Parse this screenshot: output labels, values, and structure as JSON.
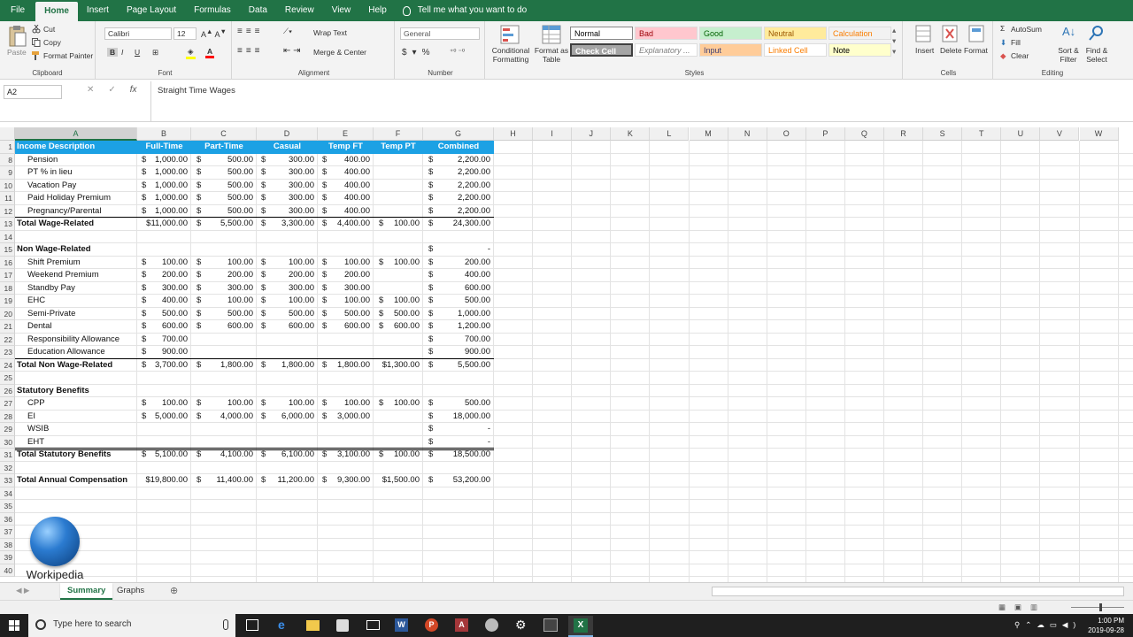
{
  "ribbon_tabs": [
    "File",
    "Home",
    "Insert",
    "Page Layout",
    "Formulas",
    "Data",
    "Review",
    "View",
    "Help"
  ],
  "active_tab": "Home",
  "tell_me": "Tell me what you want to do",
  "clipboard": {
    "paste": "Paste",
    "cut": "Cut",
    "copy": "Copy",
    "painter": "Format Painter",
    "label": "Clipboard"
  },
  "font": {
    "name": "Calibri",
    "size": "12",
    "label": "Font"
  },
  "alignment": {
    "wrap": "Wrap Text",
    "merge": "Merge & Center",
    "label": "Alignment"
  },
  "number": {
    "format": "General",
    "label": "Number"
  },
  "styles": {
    "conditional": "Conditional Formatting",
    "format_table": "Format as Table",
    "label": "Styles",
    "cells": [
      {
        "text": "Normal",
        "bg": "#ffffff",
        "fg": "#000000"
      },
      {
        "text": "Bad",
        "bg": "#ffc7ce",
        "fg": "#9c0006"
      },
      {
        "text": "Good",
        "bg": "#c6efce",
        "fg": "#006100"
      },
      {
        "text": "Neutral",
        "bg": "#ffeb9c",
        "fg": "#9c5700"
      },
      {
        "text": "Calculation",
        "bg": "#f2f2f2",
        "fg": "#fa7d00"
      },
      {
        "text": "Check Cell",
        "bg": "#a5a5a5",
        "fg": "#ffffff"
      },
      {
        "text": "Explanatory ...",
        "bg": "#ffffff",
        "fg": "#7f7f7f"
      },
      {
        "text": "Input",
        "bg": "#ffcc99",
        "fg": "#3f3f76"
      },
      {
        "text": "Linked Cell",
        "bg": "#ffffff",
        "fg": "#fa7d00"
      },
      {
        "text": "Note",
        "bg": "#ffffcc",
        "fg": "#000000"
      }
    ]
  },
  "cells_group": {
    "insert": "Insert",
    "delete": "Delete",
    "format": "Format",
    "label": "Cells"
  },
  "editing": {
    "autosum": "AutoSum",
    "fill": "Fill",
    "clear": "Clear",
    "sort": "Sort & Filter",
    "find": "Find & Select",
    "label": "Editing"
  },
  "formula_bar": {
    "name_box": "A2",
    "content": "Straight Time Wages"
  },
  "columns": [
    "A",
    "B",
    "C",
    "D",
    "E",
    "F",
    "G",
    "H",
    "I",
    "J",
    "K",
    "L",
    "M",
    "N",
    "O",
    "P",
    "Q",
    "R",
    "S",
    "T",
    "U",
    "V",
    "W"
  ],
  "header_row": [
    "Income Description",
    "Full-Time",
    "Part-Time",
    "Casual",
    "Temp FT",
    "Temp PT",
    "Combined"
  ],
  "rows": [
    {
      "r": "1"
    },
    {
      "r": "8",
      "a": "Pension",
      "indent": true,
      "v": [
        "1,000.00",
        "500.00",
        "300.00",
        "400.00",
        "",
        "2,200.00"
      ]
    },
    {
      "r": "9",
      "a": "PT % in lieu",
      "indent": true,
      "v": [
        "1,000.00",
        "500.00",
        "300.00",
        "400.00",
        "",
        "2,200.00"
      ]
    },
    {
      "r": "10",
      "a": "Vacation Pay",
      "indent": true,
      "v": [
        "1,000.00",
        "500.00",
        "300.00",
        "400.00",
        "",
        "2,200.00"
      ]
    },
    {
      "r": "11",
      "a": "Paid Holiday Premium",
      "indent": true,
      "v": [
        "1,000.00",
        "500.00",
        "300.00",
        "400.00",
        "",
        "2,200.00"
      ]
    },
    {
      "r": "12",
      "a": "Pregnancy/Parental",
      "indent": true,
      "v": [
        "1,000.00",
        "500.00",
        "300.00",
        "400.00",
        "",
        "2,200.00"
      ]
    },
    {
      "r": "13",
      "a": "Total Wage-Related",
      "bold": true,
      "total": true,
      "v": [
        "$11,000.00",
        "5,500.00",
        "3,300.00",
        "4,400.00",
        "100.00",
        "24,300.00"
      ]
    },
    {
      "r": "14"
    },
    {
      "r": "15",
      "a": "Non Wage-Related",
      "bold": true,
      "v": [
        "",
        "",
        "",
        "",
        "",
        "-"
      ]
    },
    {
      "r": "16",
      "a": "Shift Premium",
      "indent": true,
      "v": [
        "100.00",
        "100.00",
        "100.00",
        "100.00",
        "100.00",
        "200.00"
      ]
    },
    {
      "r": "17",
      "a": "Weekend Premium",
      "indent": true,
      "v": [
        "200.00",
        "200.00",
        "200.00",
        "200.00",
        "",
        "400.00"
      ]
    },
    {
      "r": "18",
      "a": "Standby Pay",
      "indent": true,
      "v": [
        "300.00",
        "300.00",
        "300.00",
        "300.00",
        "",
        "600.00"
      ]
    },
    {
      "r": "19",
      "a": "EHC",
      "indent": true,
      "v": [
        "400.00",
        "100.00",
        "100.00",
        "100.00",
        "100.00",
        "500.00"
      ]
    },
    {
      "r": "20",
      "a": "Semi-Private",
      "indent": true,
      "v": [
        "500.00",
        "500.00",
        "500.00",
        "500.00",
        "500.00",
        "1,000.00"
      ]
    },
    {
      "r": "21",
      "a": "Dental",
      "indent": true,
      "v": [
        "600.00",
        "600.00",
        "600.00",
        "600.00",
        "600.00",
        "1,200.00"
      ]
    },
    {
      "r": "22",
      "a": "Responsibility Allowance",
      "indent": true,
      "v": [
        "700.00",
        "",
        "",
        "",
        "",
        "700.00"
      ]
    },
    {
      "r": "23",
      "a": "Education Allowance",
      "indent": true,
      "v": [
        "900.00",
        "",
        "",
        "",
        "",
        "900.00"
      ]
    },
    {
      "r": "24",
      "a": "Total Non Wage-Related",
      "bold": true,
      "total": true,
      "v": [
        "3,700.00",
        "1,800.00",
        "1,800.00",
        "1,800.00",
        "$1,300.00",
        "5,500.00"
      ]
    },
    {
      "r": "25"
    },
    {
      "r": "26",
      "a": "Statutory Benefits",
      "bold": true
    },
    {
      "r": "27",
      "a": "CPP",
      "indent": true,
      "v": [
        "100.00",
        "100.00",
        "100.00",
        "100.00",
        "100.00",
        "500.00"
      ]
    },
    {
      "r": "28",
      "a": "EI",
      "indent": true,
      "v": [
        "5,000.00",
        "4,000.00",
        "6,000.00",
        "3,000.00",
        "",
        "18,000.00"
      ]
    },
    {
      "r": "29",
      "a": "WSIB",
      "indent": true,
      "v": [
        "",
        "",
        "",
        "",
        "",
        "-"
      ]
    },
    {
      "r": "30",
      "a": "EHT",
      "indent": true,
      "v": [
        "",
        "",
        "",
        "",
        "",
        "-"
      ]
    },
    {
      "r": "31",
      "a": "Total Statutory Benefits",
      "bold": true,
      "total": true,
      "v": [
        "5,100.00",
        "4,100.00",
        "6,100.00",
        "3,100.00",
        "100.00",
        "18,500.00"
      ]
    },
    {
      "r": "32"
    },
    {
      "r": "33",
      "a": "Total Annual Compensation",
      "bold": true,
      "v": [
        "$19,800.00",
        "11,400.00",
        "11,200.00",
        "9,300.00",
        "$1,500.00",
        "53,200.00"
      ]
    },
    {
      "r": "34"
    },
    {
      "r": "35"
    },
    {
      "r": "36"
    },
    {
      "r": "37"
    },
    {
      "r": "38"
    },
    {
      "r": "39"
    },
    {
      "r": "40"
    }
  ],
  "sheets": [
    "Summary",
    "Graphs"
  ],
  "active_sheet": "Summary",
  "logo_text": "Workipedia",
  "taskbar": {
    "search": "Type here to search",
    "time": "1:00 PM",
    "date": "2019-09-28"
  }
}
